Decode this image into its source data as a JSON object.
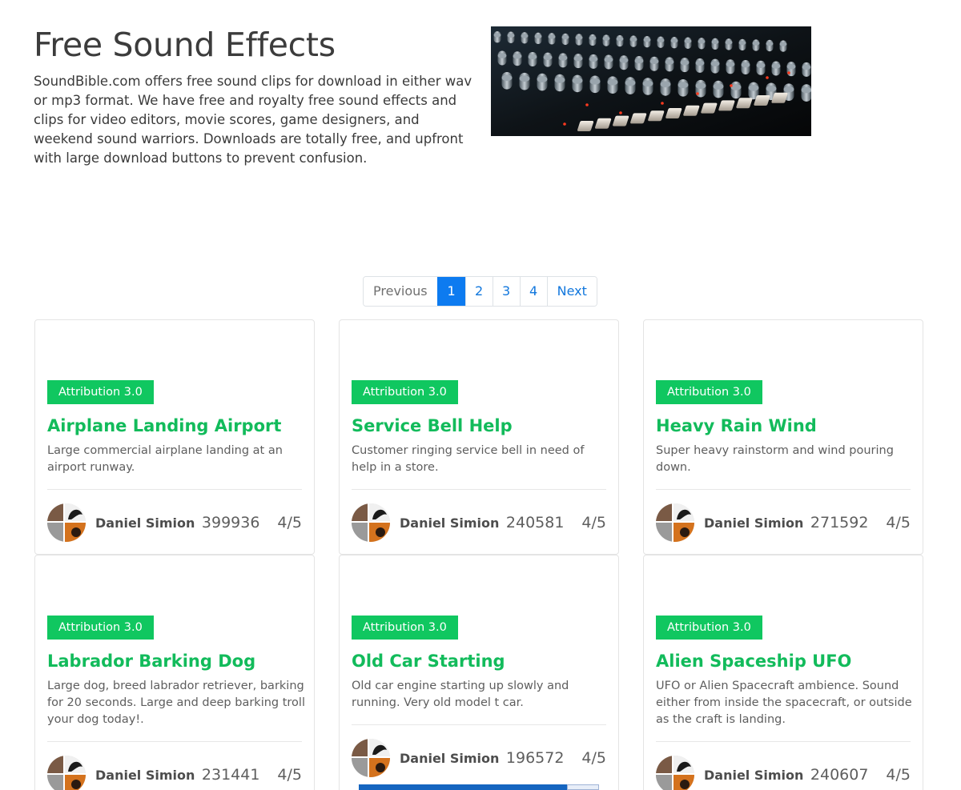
{
  "hero": {
    "title": "Free Sound Effects",
    "description": "SoundBible.com offers free sound clips for download in either wav or mp3 format. We have free and royalty free sound effects and clips for video editors, movie scores, game designers, and weekend sound warriors. Downloads are totally free, and upfront with large download buttons to prevent confusion.",
    "image_icon": "mixing-console-photo"
  },
  "pagination": {
    "previous": "Previous",
    "pages": [
      "1",
      "2",
      "3",
      "4"
    ],
    "active": "1",
    "next": "Next"
  },
  "colors": {
    "accent_green": "#12bb5b",
    "badge_green": "#10c760",
    "link_blue": "#1177dd",
    "active_blue": "#0d7bf0"
  },
  "cards": [
    {
      "badge": "Attribution 3.0",
      "title": "Airplane Landing Airport",
      "description": "Large commercial airplane landing at an airport runway.",
      "author": "Daniel Simion",
      "downloads": "399936",
      "rating": "4/5"
    },
    {
      "badge": "Attribution 3.0",
      "title": "Service Bell Help",
      "description": "Customer ringing service bell in need of help in a store.",
      "author": "Daniel Simion",
      "downloads": "240581",
      "rating": "4/5"
    },
    {
      "badge": "Attribution 3.0",
      "title": "Heavy Rain Wind",
      "description": "Super heavy rainstorm and wind pouring down.",
      "author": "Daniel Simion",
      "downloads": "271592",
      "rating": "4/5"
    },
    {
      "badge": "Attribution 3.0",
      "title": "Labrador Barking Dog",
      "description": "Large dog, breed labrador retriever, barking for 20 seconds. Large and deep barking troll your dog today!.",
      "author": "Daniel Simion",
      "downloads": "231441",
      "rating": "4/5"
    },
    {
      "badge": "Attribution 3.0",
      "title": "Old Car Starting",
      "description": "Old car engine starting up slowly and running. Very old model t car.",
      "author": "Daniel Simion",
      "downloads": "196572",
      "rating": "4/5"
    },
    {
      "badge": "Attribution 3.0",
      "title": "Alien Spaceship UFO",
      "description": "UFO or Alien Spacecraft ambience. Sound either from inside the spacecraft, or outside as the craft is landing.",
      "author": "Daniel Simion",
      "downloads": "240607",
      "rating": "4/5"
    }
  ]
}
